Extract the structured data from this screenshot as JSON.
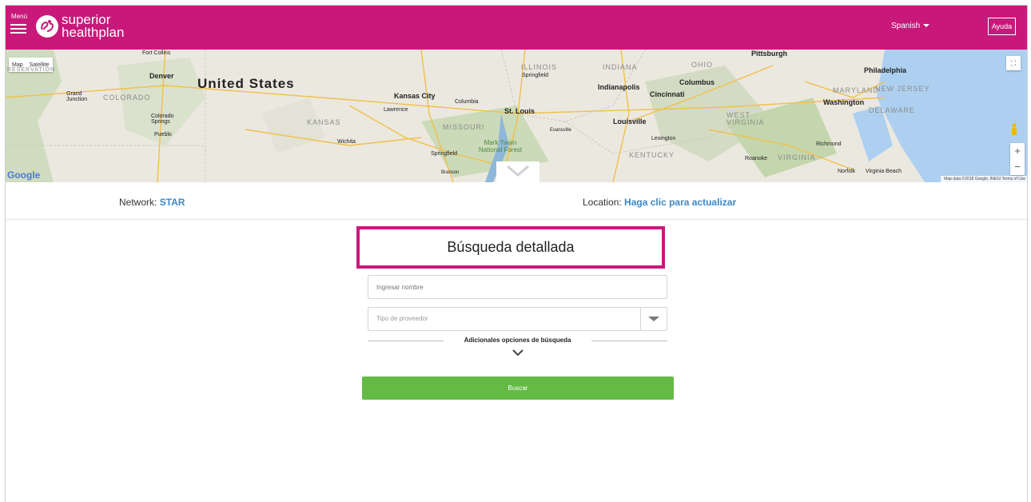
{
  "header": {
    "menu_label": "Menú",
    "logo_line1": "superior",
    "logo_line2": "healthplan",
    "language": "Spanish",
    "help": "Ayuda",
    "brand_color": "#c8197b"
  },
  "map": {
    "type_map": "Map",
    "type_satellite": "Satellite",
    "attribution": "Map data ©2018 Google, INEGI   Terms of Use",
    "google": "Google",
    "zoom_in": "+",
    "zoom_out": "−",
    "labels": {
      "reservation": "RESERVATION",
      "fort_collins": "Fort Collins",
      "denver": "Denver",
      "united_states": "United States",
      "grand_junction": "Grand Junction",
      "colorado": "COLORADO",
      "colorado_springs": "Colorado Springs",
      "pueblo": "Pueblo",
      "kansas": "KANSAS",
      "wichita": "Wichita",
      "kansas_city": "Kansas City",
      "lawrence": "Lawrence",
      "columbia": "Columbia",
      "st_louis": "St. Louis",
      "missouri": "MISSOURI",
      "springfield_mo": "Springfield",
      "branson": "Branson",
      "mark_twain": "Mark Twain National Forest",
      "illinois": "ILLINOIS",
      "springfield_il": "Springfield",
      "indiana": "INDIANA",
      "indianapolis": "Indianapolis",
      "evansville": "Evansville",
      "louisville": "Louisville",
      "lexington": "Lexington",
      "kentucky": "KENTUCKY",
      "ohio": "OHIO",
      "columbus": "Columbus",
      "cincinnati": "Cincinnati",
      "pittsburgh": "Pittsburgh",
      "west_virginia": "WEST VIRGINIA",
      "virginia": "VIRGINIA",
      "roanoke": "Roanoke",
      "richmond": "Richmond",
      "norfolk": "Norfolk",
      "virginia_beach": "Virginia Beach",
      "washington": "Washington",
      "maryland": "MARYLAND",
      "new_jersey": "NEW JERSEY",
      "delaware": "DELAWARE",
      "philadelphia": "Philadelphia"
    }
  },
  "info": {
    "network_label": "Network:",
    "network_value": "STAR",
    "location_label": "Location:",
    "location_value": "Haga clic para actualizar"
  },
  "search": {
    "title": "Búsqueda detallada",
    "name_placeholder": "Ingresar nombre",
    "provider_type_placeholder": "Tipo de proveedor",
    "advanced_label": "Adicionales opciones de búsqueda",
    "search_button": "Buscar",
    "button_color": "#63bb44"
  }
}
